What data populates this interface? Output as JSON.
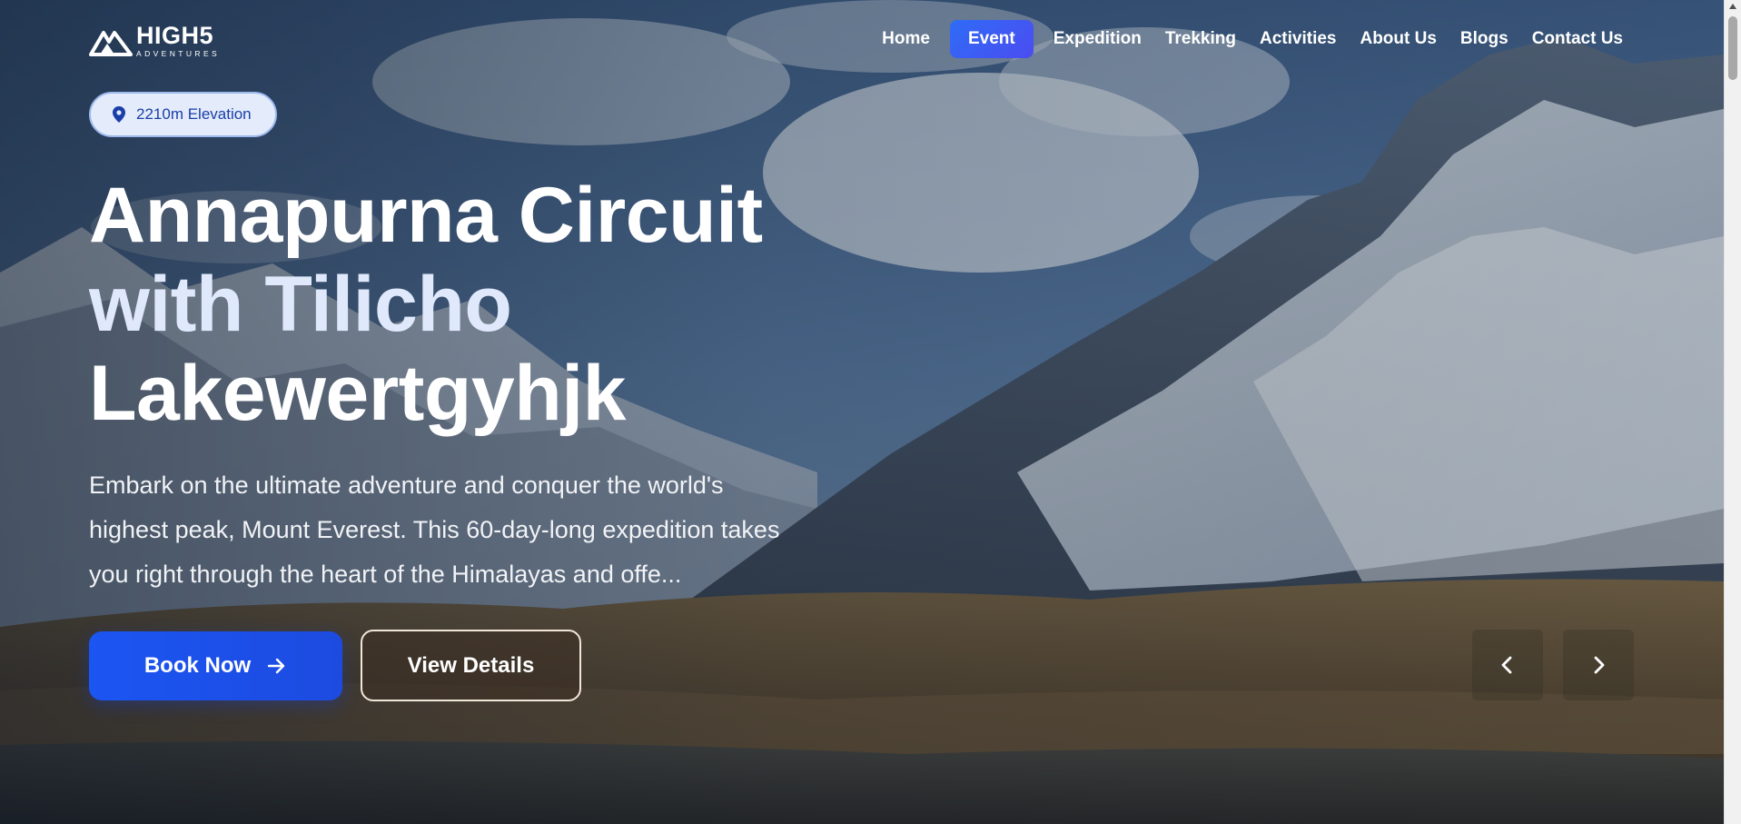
{
  "brand": {
    "name": "HIGH5",
    "tagline": "ADVENTURES"
  },
  "nav": {
    "items": [
      {
        "label": "Home",
        "active": false
      },
      {
        "label": "Event",
        "active": true
      },
      {
        "label": "Expedition",
        "active": false
      },
      {
        "label": "Trekking",
        "active": false
      },
      {
        "label": "Activities",
        "active": false
      },
      {
        "label": "About Us",
        "active": false
      },
      {
        "label": "Blogs",
        "active": false
      },
      {
        "label": "Contact Us",
        "active": false
      }
    ]
  },
  "hero": {
    "badge": {
      "icon": "location-pin-icon",
      "label": "2210m Elevation"
    },
    "title_line1": "Annapurna Circuit",
    "title_line2": "with Tilicho",
    "title_line3": "Lakewertgyhjk",
    "description": "Embark on the ultimate adventure and conquer the world's highest peak, Mount Everest. This 60-day-long expedition takes you right through the heart of the Himalayas and offe...",
    "primary_button": {
      "label": "Book Now",
      "icon": "arrow-right-icon"
    },
    "secondary_button": {
      "label": "View Details"
    }
  },
  "slider": {
    "prev_icon": "chevron-left-icon",
    "next_icon": "chevron-right-icon"
  },
  "colors": {
    "accent": "#1b55f2",
    "nav_active": "#3b5cf4",
    "badge_bg": "#e4ecfb",
    "badge_text": "#1a3ea8"
  }
}
